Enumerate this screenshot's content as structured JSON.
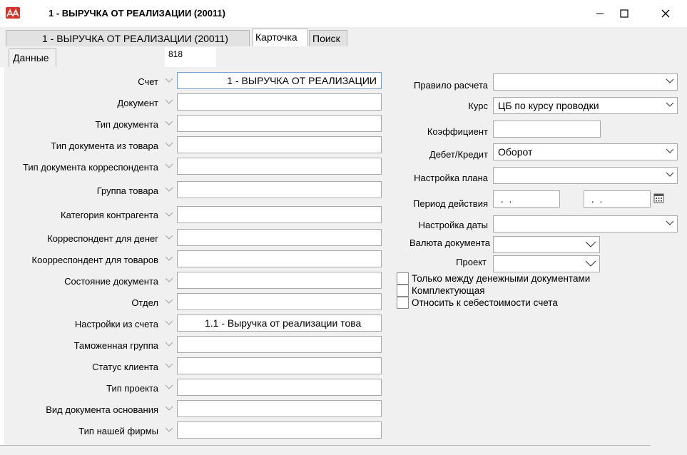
{
  "window": {
    "title": "1 - ВЫРУЧКА ОТ РЕАЛИЗАЦИИ (20011)"
  },
  "tabs": [
    {
      "label": "1 - ВЫРУЧКА ОТ РЕАЛИЗАЦИИ (20011)"
    },
    {
      "label": "Карточка"
    },
    {
      "label": "Поиск"
    }
  ],
  "subtab": {
    "label": "Данные"
  },
  "code": "818",
  "left_fields": [
    {
      "label": "Счет",
      "value": "1 - ВЫРУЧКА ОТ РЕАЛИЗАЦИИ"
    },
    {
      "label": "Документ",
      "value": ""
    },
    {
      "label": "Тип документа",
      "value": ""
    },
    {
      "label": "Тип документа из товара",
      "value": ""
    },
    {
      "label": "Тип документа корреспондента",
      "value": ""
    },
    {
      "label": "Группа товара",
      "value": ""
    },
    {
      "label": "Категория контрагента",
      "value": ""
    },
    {
      "label": "Корреспондент для денег",
      "value": ""
    },
    {
      "label": "Коорреспондент для товаров",
      "value": ""
    },
    {
      "label": "Состояние документа",
      "value": ""
    },
    {
      "label": "Отдел",
      "value": ""
    },
    {
      "label": "Настройки из счета",
      "value": "1.1 - Выручка от реализации това"
    },
    {
      "label": "Таможенная группа",
      "value": ""
    },
    {
      "label": "Статус клиента",
      "value": ""
    },
    {
      "label": "Тип проекта",
      "value": ""
    },
    {
      "label": "Вид документа основания",
      "value": ""
    },
    {
      "label": "Тип нашей фирмы",
      "value": ""
    }
  ],
  "right_fields": {
    "calc_rule": {
      "label": "Правило расчета",
      "value": ""
    },
    "rate": {
      "label": "Курс",
      "value": "ЦБ по курсу проводки"
    },
    "coef": {
      "label": "Коэффициент",
      "value": ""
    },
    "debit_credit": {
      "label": "Дебет/Кредит",
      "value": "Оборот"
    },
    "plan_setting": {
      "label": "Настройка плана",
      "value": ""
    },
    "period": {
      "label": "Период действия",
      "from": " .  .",
      "to": " .  ."
    },
    "date_setting": {
      "label": "Настройка даты",
      "value": ""
    },
    "currency": {
      "label": "Валюта документа",
      "value": ""
    },
    "project": {
      "label": "Проект",
      "value": ""
    }
  },
  "checkboxes": [
    {
      "label": "Только между денежными документами",
      "checked": false
    },
    {
      "label": "Комплектующая",
      "checked": false
    },
    {
      "label": "Относить к себестоимости счета",
      "checked": false
    }
  ],
  "colors": {
    "logo": "#d93025",
    "panel": "#f0f0f0",
    "focus_border": "#7a9fd3"
  }
}
